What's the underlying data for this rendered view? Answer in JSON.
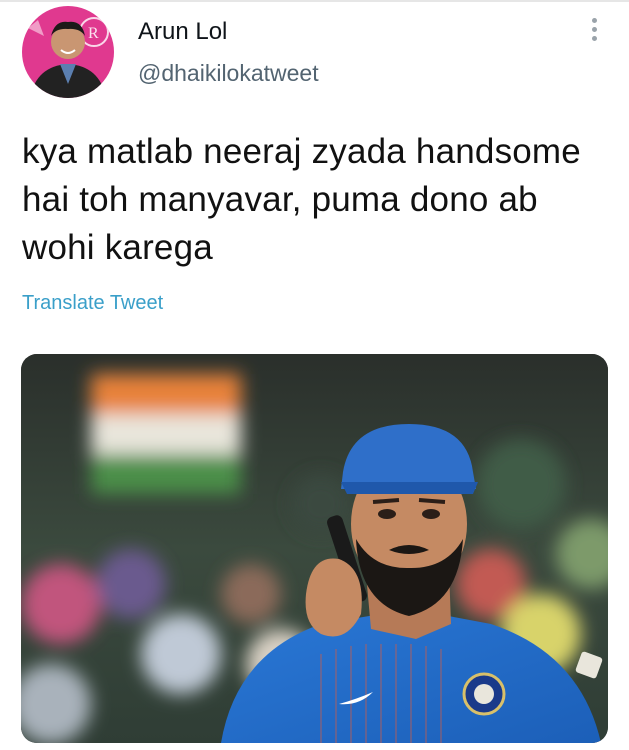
{
  "tweet": {
    "author_name": "Arun Lol",
    "author_handle": "@dhaikilokatweet",
    "text": "kya matlab neeraj zyada handsome hai toh manyavar, puma dono ab wohi karega",
    "translate_label": "Translate Tweet"
  },
  "icons": {
    "more": "vertical-ellipsis-icon"
  },
  "colors": {
    "handle": "#536471",
    "translate_link": "#3a9fc9",
    "avatar_ring": "#e0398f"
  }
}
